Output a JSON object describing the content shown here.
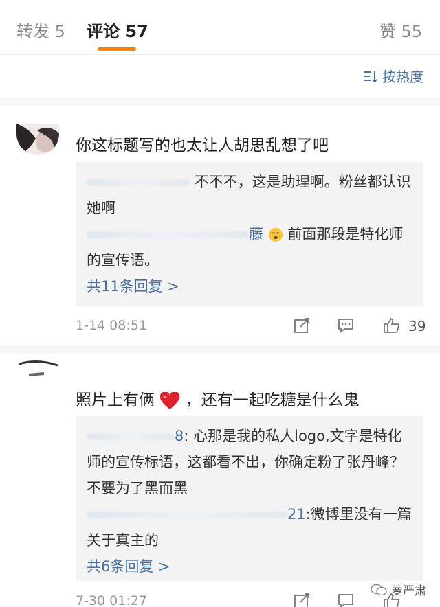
{
  "tabs": {
    "reposts": "转发 5",
    "comments": "评论 57",
    "likes": "赞 55"
  },
  "sort": {
    "label": "按热度",
    "icon": "sort-icon"
  },
  "comments": [
    {
      "text": "你这标题写的也太让人胡思乱想了吧",
      "replies": [
        {
          "text": "不不不，这是助理啊。粉丝都认识她啊"
        },
        {
          "name_tail": "藤",
          "text": "前面那段是特化师的宣传语。"
        }
      ],
      "more": "共11条回复 >",
      "time": "1-14 08:51",
      "likes": "39"
    },
    {
      "text": "照片上有俩",
      "text_after": "，还有一起吃糖是什么鬼",
      "replies": [
        {
          "name_tail": "8",
          "text": ": 心那是我的私人logo,文字是特化师的宣传标语，这都看不出，你确定粉了张丹峰？不要为了黑而黑"
        },
        {
          "name_tail": "21",
          "text": ":微博里没有一篇关于真主的"
        }
      ],
      "more": "共6条回复 >",
      "time": "7-30 01:27"
    }
  ],
  "watermark": {
    "label": "萝严肃"
  },
  "colors": {
    "accent": "#ff8200",
    "link": "#486f9e",
    "muted": "#999999"
  }
}
